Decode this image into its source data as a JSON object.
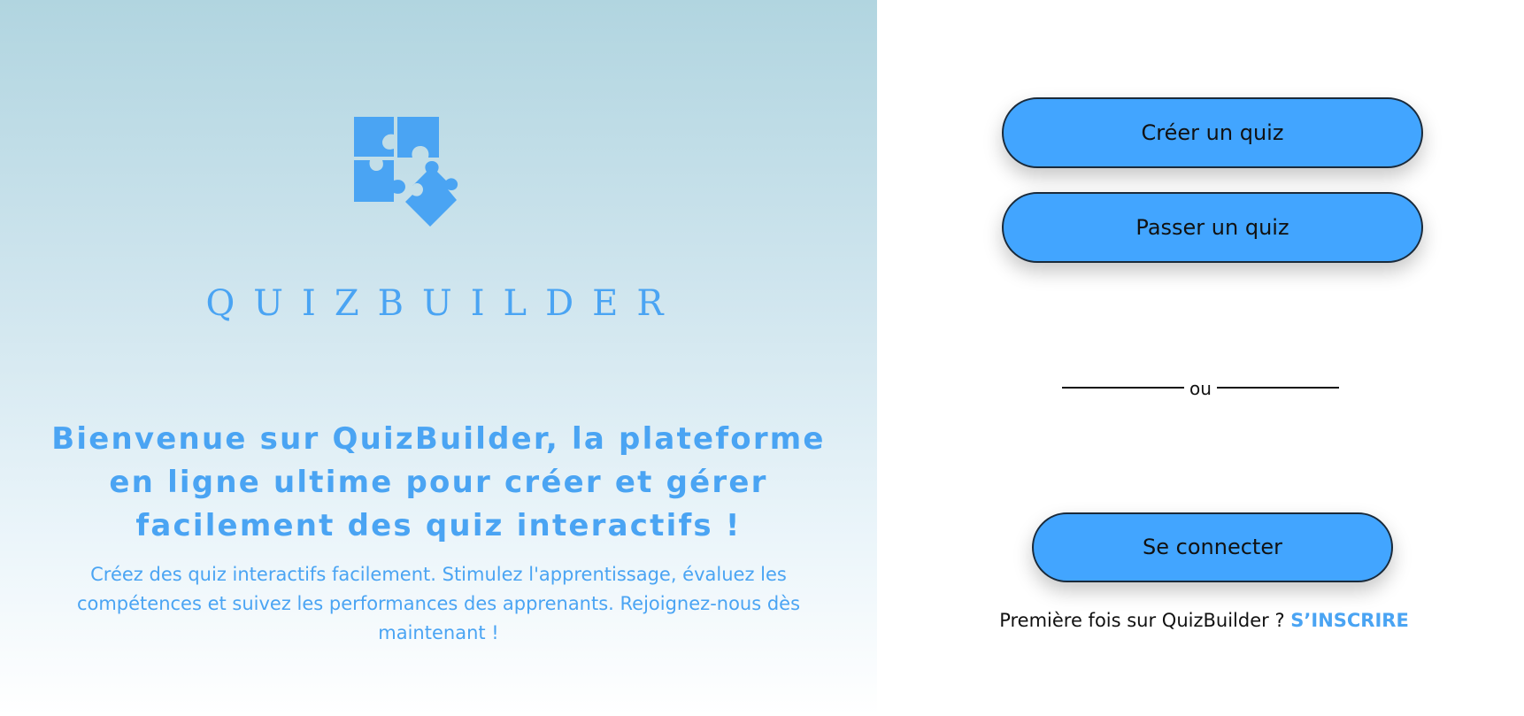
{
  "brand": {
    "name": "QUIZBUILDER",
    "logo_icon": "puzzle-pieces-icon",
    "accent_color": "#4aa4f3"
  },
  "hero": {
    "headline": "Bienvenue sur QuizBuilder, la plateforme en ligne ultime pour créer et gérer facilement des quiz interactifs !",
    "subtext": "Créez des quiz interactifs facilement. Stimulez l'apprentissage, évaluez les compétences et suivez les performances des apprenants. Rejoignez-nous dès maintenant !"
  },
  "actions": {
    "create_quiz_label": "Créer un quiz",
    "take_quiz_label": "Passer un quiz",
    "divider_label": "ou",
    "login_label": "Se connecter",
    "button_color": "#42a5ff"
  },
  "signup": {
    "prompt": "Première fois sur QuizBuilder ?",
    "link_label": "S’INSCRIRE"
  }
}
